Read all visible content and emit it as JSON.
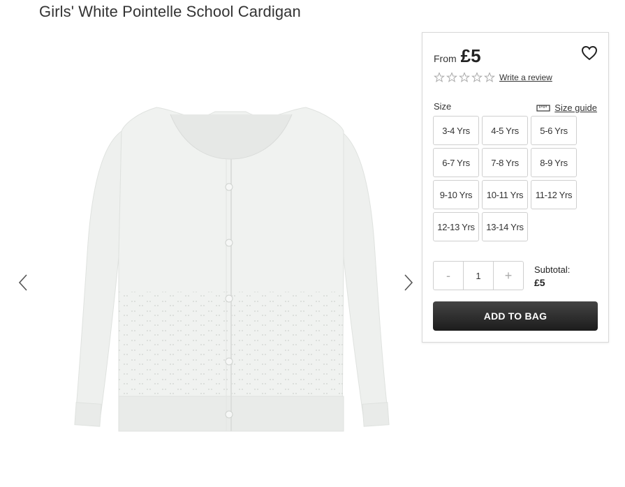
{
  "product": {
    "title": "Girls' White Pointelle School Cardigan"
  },
  "gallery": {
    "prev_icon": "chevron-left-icon",
    "next_icon": "chevron-right-icon"
  },
  "pricing": {
    "from_label": "From",
    "price": "£5"
  },
  "rating": {
    "stars_filled": 0,
    "stars_total": 5,
    "review_link": "Write a review"
  },
  "size": {
    "label": "Size",
    "guide_label": "Size guide",
    "options": [
      "3-4 Yrs",
      "4-5 Yrs",
      "5-6 Yrs",
      "6-7 Yrs",
      "7-8 Yrs",
      "8-9 Yrs",
      "9-10 Yrs",
      "10-11 Yrs",
      "11-12 Yrs",
      "12-13 Yrs",
      "13-14 Yrs"
    ]
  },
  "quantity": {
    "minus": "-",
    "value": "1",
    "plus": "+"
  },
  "subtotal": {
    "label": "Subtotal:",
    "value": "£5"
  },
  "actions": {
    "add_to_bag": "ADD TO BAG"
  },
  "colors": {
    "button_bg": "#2b2b2b",
    "border": "#cfcfcf"
  }
}
